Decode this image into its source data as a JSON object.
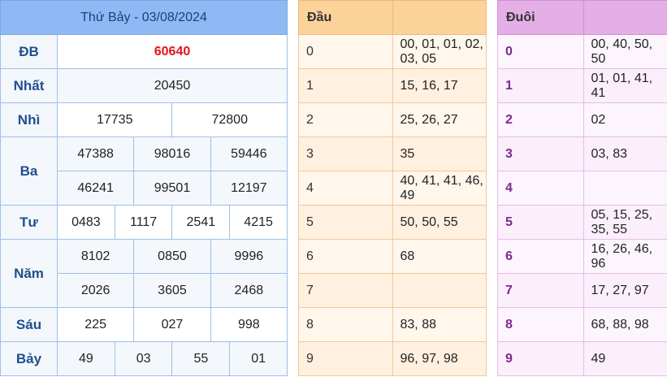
{
  "results": {
    "title": "Thứ Bảy - 03/08/2024",
    "rows": {
      "db": {
        "label": "ĐB",
        "values": [
          "60640"
        ]
      },
      "nhat": {
        "label": "Nhất",
        "values": [
          "20450"
        ]
      },
      "nhi": {
        "label": "Nhì",
        "values": [
          "17735",
          "72800"
        ]
      },
      "ba": {
        "label": "Ba",
        "values": [
          "47388",
          "98016",
          "59446",
          "46241",
          "99501",
          "12197"
        ]
      },
      "tu": {
        "label": "Tư",
        "values": [
          "0483",
          "1117",
          "2541",
          "4215"
        ]
      },
      "nam": {
        "label": "Năm",
        "values": [
          "8102",
          "0850",
          "9996",
          "2026",
          "3605",
          "2468"
        ]
      },
      "sau": {
        "label": "Sáu",
        "values": [
          "225",
          "027",
          "998"
        ]
      },
      "bay": {
        "label": "Bảy",
        "values": [
          "49",
          "03",
          "55",
          "01"
        ]
      }
    }
  },
  "dau": {
    "title": "Đầu",
    "rows": [
      {
        "digit": "0",
        "values": "00, 01, 01, 02, 03, 05"
      },
      {
        "digit": "1",
        "values": "15, 16, 17"
      },
      {
        "digit": "2",
        "values": "25, 26, 27"
      },
      {
        "digit": "3",
        "values": "35"
      },
      {
        "digit": "4",
        "values": "40, 41, 41, 46, 49"
      },
      {
        "digit": "5",
        "values": "50, 50, 55"
      },
      {
        "digit": "6",
        "values": "68"
      },
      {
        "digit": "7",
        "values": ""
      },
      {
        "digit": "8",
        "values": "83, 88"
      },
      {
        "digit": "9",
        "values": "96, 97, 98"
      }
    ]
  },
  "duoi": {
    "title": "Đuôi",
    "rows": [
      {
        "digit": "0",
        "values": "00, 40, 50, 50"
      },
      {
        "digit": "1",
        "values": "01, 01, 41, 41"
      },
      {
        "digit": "2",
        "values": "02"
      },
      {
        "digit": "3",
        "values": "03, 83"
      },
      {
        "digit": "4",
        "values": ""
      },
      {
        "digit": "5",
        "values": "05, 15, 25, 35, 55"
      },
      {
        "digit": "6",
        "values": "16, 26, 46, 96"
      },
      {
        "digit": "7",
        "values": "17, 27, 97"
      },
      {
        "digit": "8",
        "values": "68, 88, 98"
      },
      {
        "digit": "9",
        "values": "49"
      }
    ]
  },
  "colors": {
    "results_header": "#8fb9f4",
    "dau_header": "#fbd29a",
    "duoi_header": "#e4aee6",
    "special_prize": "#e4141b"
  }
}
